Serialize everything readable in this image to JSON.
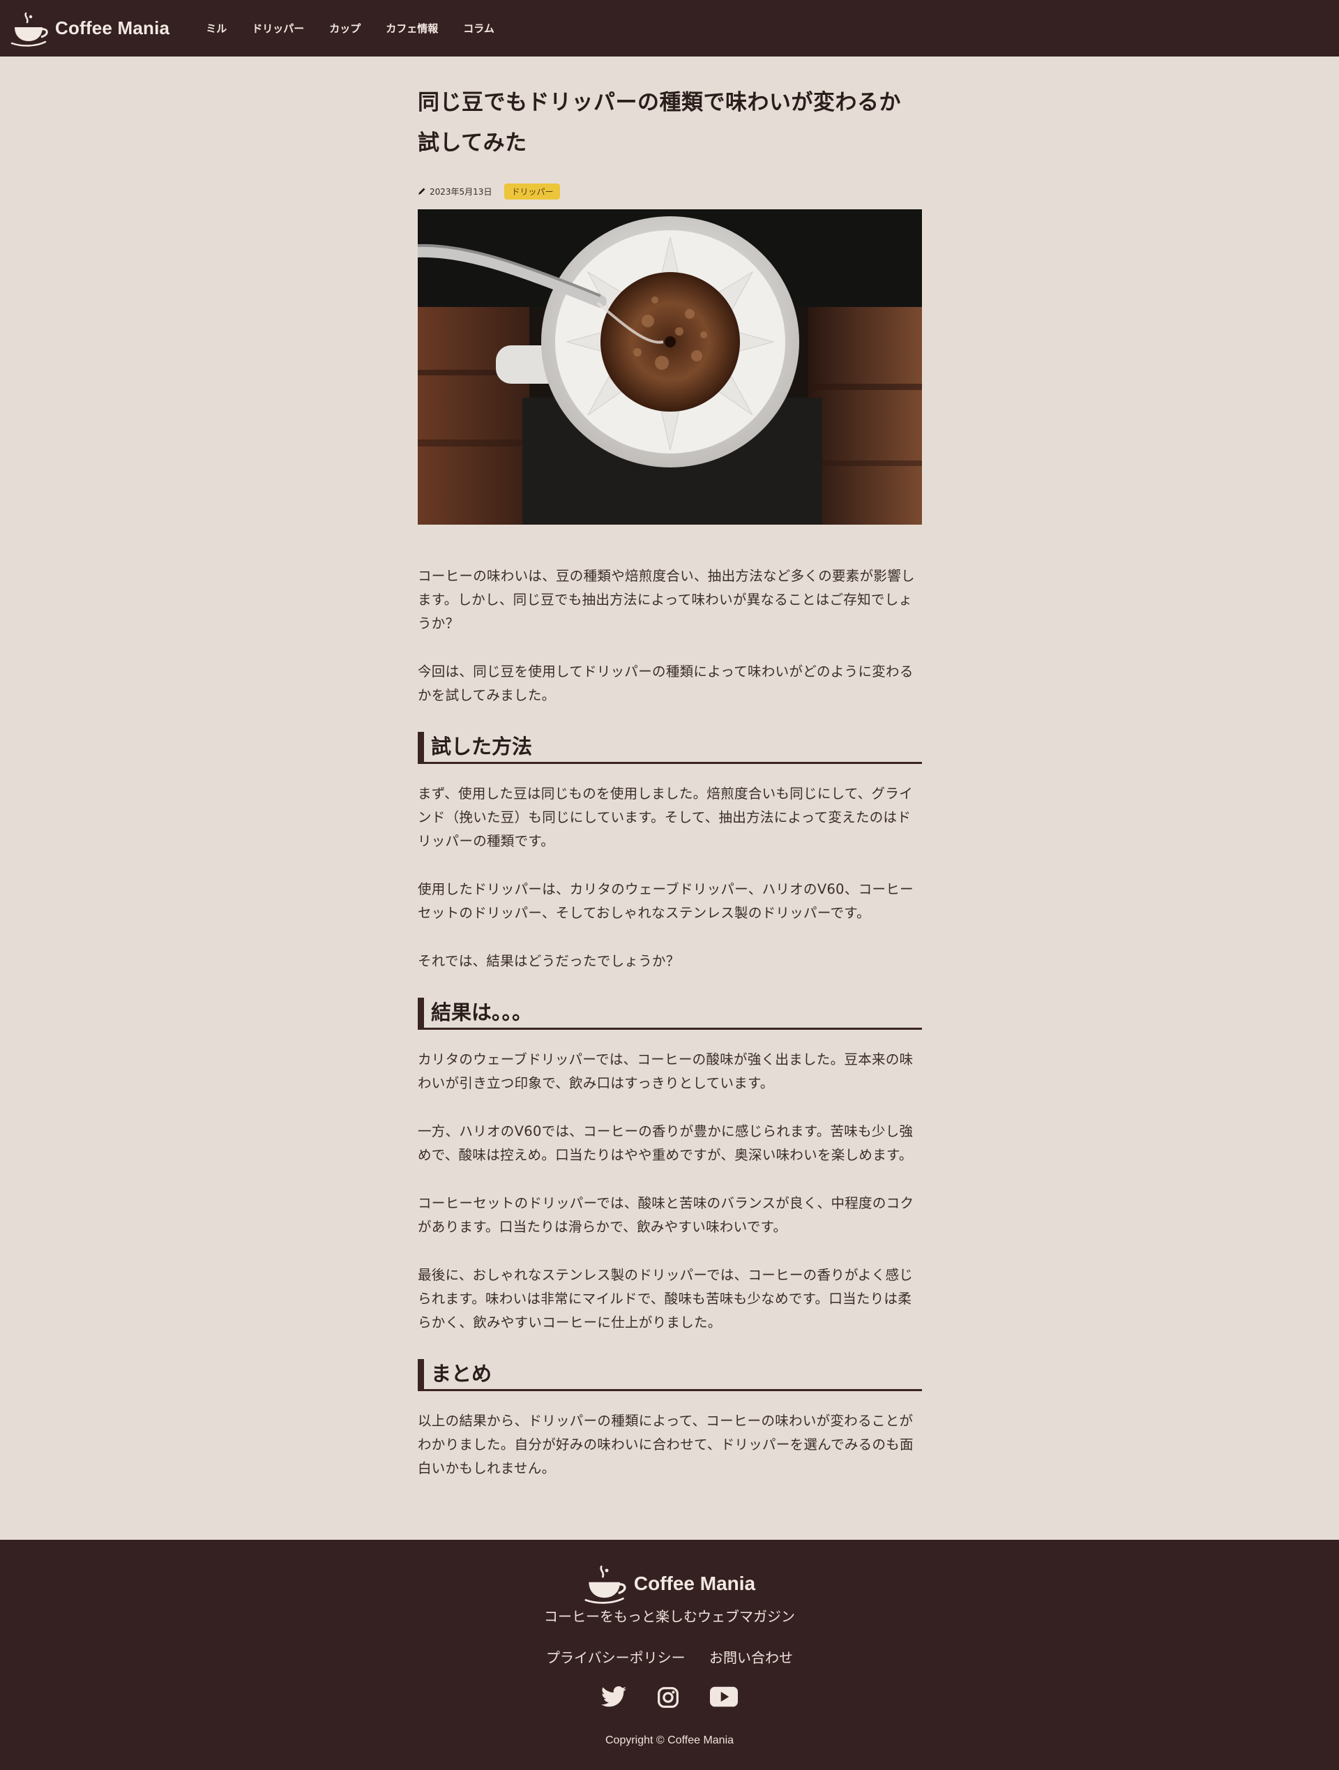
{
  "header": {
    "logo_text": "Coffee Mania",
    "nav": [
      "ミル",
      "ドリッパー",
      "カップ",
      "カフェ情報",
      "コラム"
    ]
  },
  "article": {
    "title_line1": "同じ豆でもドリッパーの種類で味わいが変わるか",
    "title_line2": "試してみた",
    "date": "2023年5月13日",
    "tag": "ドリッパー",
    "hero_image": "pour-over-coffee-dripper-photo",
    "paragraphs_intro": [
      "コーヒーの味わいは、豆の種類や焙煎度合い、抽出方法など多くの要素が影響します。しかし、同じ豆でも抽出方法によって味わいが異なることはご存知でしょうか？",
      "今回は、同じ豆を使用してドリッパーの種類によって味わいがどのように変わるかを試してみました。"
    ],
    "section1": {
      "heading": "試した方法",
      "paragraphs": [
        "まず、使用した豆は同じものを使用しました。焙煎度合いも同じにして、グラインド（挽いた豆）も同じにしています。そして、抽出方法によって変えたのはドリッパーの種類です。",
        "使用したドリッパーは、カリタのウェーブドリッパー、ハリオのV60、コーヒーセットのドリッパー、そしておしゃれなステンレス製のドリッパーです。",
        "それでは、結果はどうだったでしょうか？"
      ]
    },
    "section2": {
      "heading": "結果は。。。",
      "paragraphs": [
        "カリタのウェーブドリッパーでは、コーヒーの酸味が強く出ました。豆本来の味わいが引き立つ印象で、飲み口はすっきりとしています。",
        "一方、ハリオのV60では、コーヒーの香りが豊かに感じられます。苦味も少し強めで、酸味は控えめ。口当たりはやや重めですが、奥深い味わいを楽しめます。",
        "コーヒーセットのドリッパーでは、酸味と苦味のバランスが良く、中程度のコクがあります。口当たりは滑らかで、飲みやすい味わいです。",
        "最後に、おしゃれなステンレス製のドリッパーでは、コーヒーの香りがよく感じられます。味わいは非常にマイルドで、酸味も苦味も少なめです。口当たりは柔らかく、飲みやすいコーヒーに仕上がりました。"
      ]
    },
    "section3": {
      "heading": "まとめ",
      "paragraphs": [
        "以上の結果から、ドリッパーの種類によって、コーヒーの味わいが変わることがわかりました。自分が好みの味わいに合わせて、ドリッパーを選んでみるのも面白いかもしれません。"
      ]
    }
  },
  "footer": {
    "logo_text": "Coffee Mania",
    "tagline": "コーヒーをもっと楽しむウェブマガジン",
    "links": [
      "プライバシーポリシー",
      "お問い合わせ"
    ],
    "social_icons": [
      "twitter-icon",
      "instagram-icon",
      "youtube-icon"
    ],
    "copyright": "Copyright © Coffee Mania"
  },
  "colors": {
    "header_bg": "#352121",
    "page_bg": "#e5ddd5",
    "tag_bg": "#ecc53a",
    "heading_accent": "#3a2424"
  }
}
